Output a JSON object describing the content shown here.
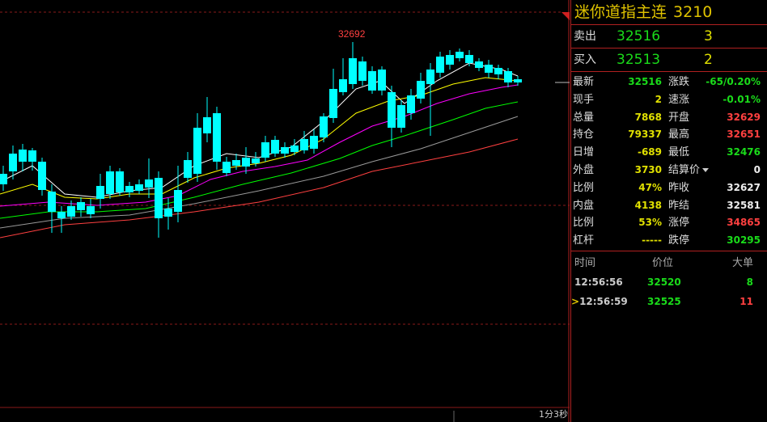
{
  "chart": {
    "peak_label": "32692",
    "timeframe": "1分3秒",
    "colors": {
      "up": "#ff3b3b",
      "down": "#00ffff",
      "ma5": "#ffffff",
      "ma10": "#ffff00",
      "ma20": "#ff00ff",
      "ma30": "#00ff00",
      "ma60": "#999999",
      "ma120": "#ff4040"
    }
  },
  "panel": {
    "title": "迷你道指主连",
    "code": "3210",
    "sell": {
      "label": "卖出",
      "price": "32516",
      "vol": "3"
    },
    "buy": {
      "label": "买入",
      "price": "32513",
      "vol": "2"
    },
    "stats": [
      {
        "l1": "最新",
        "v1": "32516",
        "c1": "g",
        "l2": "涨跌",
        "v2": "-65/0.20%",
        "c2": "g"
      },
      {
        "l1": "现手",
        "v1": "2",
        "c1": "y",
        "l2": "速涨",
        "v2": "-0.01%",
        "c2": "g"
      },
      {
        "l1": "总量",
        "v1": "7868",
        "c1": "y",
        "l2": "开盘",
        "v2": "32629",
        "c2": "r"
      },
      {
        "l1": "持仓",
        "v1": "79337",
        "c1": "y",
        "l2": "最高",
        "v2": "32651",
        "c2": "r"
      },
      {
        "l1": "日增",
        "v1": "-689",
        "c1": "y",
        "l2": "最低",
        "v2": "32476",
        "c2": "g"
      },
      {
        "l1": "外盘",
        "v1": "3730",
        "c1": "y",
        "l2": "结算价",
        "v2": "0",
        "c2": "w"
      },
      {
        "l1": "比例",
        "v1": "47%",
        "c1": "y",
        "l2": "昨收",
        "v2": "32627",
        "c2": "w"
      },
      {
        "l1": "内盘",
        "v1": "4138",
        "c1": "y",
        "l2": "昨结",
        "v2": "32581",
        "c2": "w"
      },
      {
        "l1": "比例",
        "v1": "53%",
        "c1": "y",
        "l2": "涨停",
        "v2": "34865",
        "c2": "r"
      },
      {
        "l1": "杠杆",
        "v1": "-----",
        "c1": "y",
        "l2": "跌停",
        "v2": "30295",
        "c2": "g"
      }
    ],
    "ticks_header": {
      "time": "时间",
      "price": "价位",
      "vol": "大单"
    },
    "ticks": [
      {
        "time": "12:56:56",
        "price": "32520",
        "vol": "8",
        "vc": "g",
        "marker": ""
      },
      {
        "time": "12:56:59",
        "price": "32525",
        "vol": "11",
        "vc": "r",
        "marker": ">"
      }
    ]
  }
}
